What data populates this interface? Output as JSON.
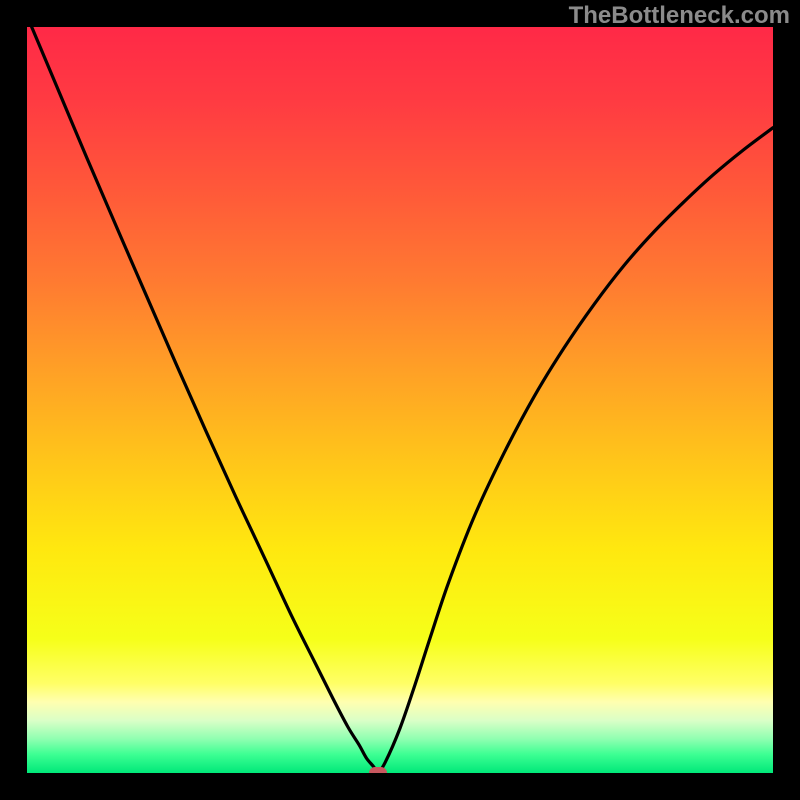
{
  "watermark": "TheBottleneck.com",
  "chart_data": {
    "type": "line",
    "title": "",
    "xlabel": "",
    "ylabel": "",
    "xlim": [
      0,
      1
    ],
    "ylim": [
      0,
      1
    ],
    "background_gradient_stops": [
      {
        "offset": 0.0,
        "color": "#ff2947"
      },
      {
        "offset": 0.1,
        "color": "#ff3b42"
      },
      {
        "offset": 0.22,
        "color": "#ff5939"
      },
      {
        "offset": 0.34,
        "color": "#ff7a31"
      },
      {
        "offset": 0.46,
        "color": "#ffa026"
      },
      {
        "offset": 0.58,
        "color": "#ffc51a"
      },
      {
        "offset": 0.7,
        "color": "#ffe80f"
      },
      {
        "offset": 0.82,
        "color": "#f6ff19"
      },
      {
        "offset": 0.88,
        "color": "#ffff66"
      },
      {
        "offset": 0.905,
        "color": "#ffffb0"
      },
      {
        "offset": 0.93,
        "color": "#d9ffc7"
      },
      {
        "offset": 0.955,
        "color": "#8dffb0"
      },
      {
        "offset": 0.975,
        "color": "#3dff93"
      },
      {
        "offset": 1.0,
        "color": "#00e879"
      }
    ],
    "series": [
      {
        "name": "bottleneck-curve",
        "color": "#000000",
        "x": [
          0.0,
          0.04,
          0.08,
          0.12,
          0.16,
          0.2,
          0.24,
          0.28,
          0.32,
          0.355,
          0.385,
          0.41,
          0.43,
          0.445,
          0.455,
          0.465,
          0.47,
          0.48,
          0.5,
          0.52,
          0.54,
          0.565,
          0.6,
          0.64,
          0.68,
          0.72,
          0.76,
          0.8,
          0.84,
          0.88,
          0.92,
          0.96,
          1.0
        ],
        "y": [
          1.015,
          0.92,
          0.825,
          0.732,
          0.64,
          0.548,
          0.458,
          0.37,
          0.285,
          0.21,
          0.15,
          0.1,
          0.062,
          0.038,
          0.02,
          0.008,
          0.0,
          0.014,
          0.06,
          0.118,
          0.18,
          0.255,
          0.345,
          0.43,
          0.505,
          0.57,
          0.628,
          0.68,
          0.725,
          0.765,
          0.802,
          0.835,
          0.865
        ]
      }
    ],
    "marker": {
      "name": "bottleneck-marker",
      "x": 0.47,
      "y": 0.0,
      "color": "#c8585f"
    }
  }
}
